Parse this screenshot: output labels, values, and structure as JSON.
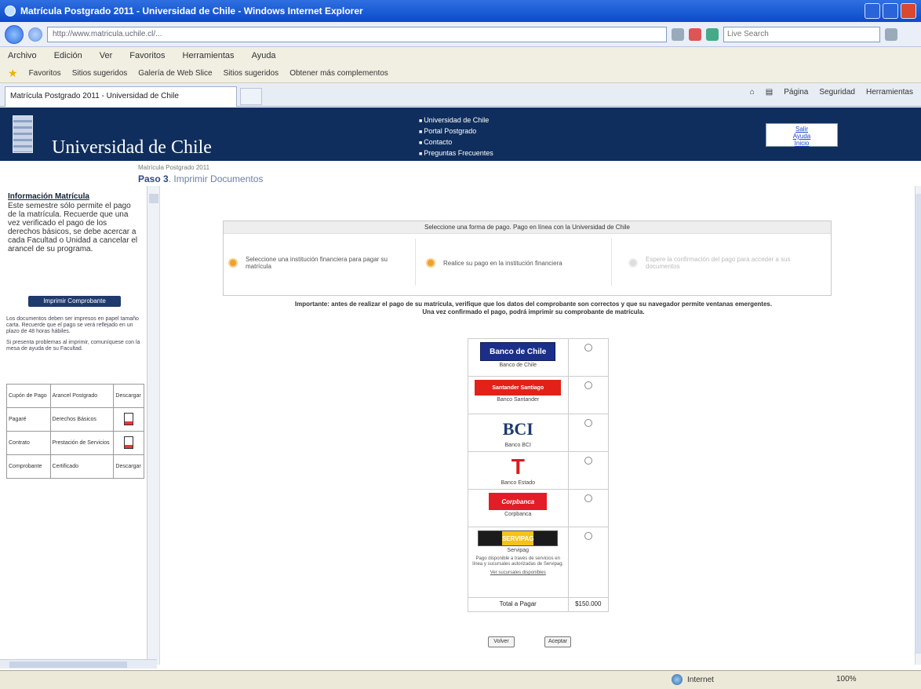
{
  "window": {
    "title": "Matrícula Postgrado 2011 - Universidad de Chile - Windows Internet Explorer"
  },
  "browser": {
    "url": "http://www.matricula.uchile.cl/...",
    "search_placeholder": "Live Search",
    "menu": [
      "Archivo",
      "Edición",
      "Ver",
      "Favoritos",
      "Herramientas",
      "Ayuda"
    ],
    "favorites_label": "Favoritos",
    "favorites": [
      "Sitios sugeridos",
      "Galería de Web Slice",
      "Sitios sugeridos",
      "Obtener más complementos"
    ],
    "tab_title": "Matrícula Postgrado 2011 - Universidad de Chile",
    "commands": [
      "Página",
      "Seguridad",
      "Herramientas"
    ]
  },
  "banner": {
    "university": "Universidad de Chile",
    "links": [
      "Universidad de Chile",
      "Portal Postgrado",
      "Contacto",
      "Preguntas Frecuentes"
    ],
    "login": [
      "Salir",
      "Ayuda",
      "Inicio"
    ]
  },
  "page": {
    "under_banner": "Matrícula Postgrado 2011",
    "heading_bold": "Paso 3",
    "heading_rest": ". Imprimir Documentos"
  },
  "sidebar": {
    "title": "Información Matrícula",
    "text": "Este semestre sólo permite el pago de la matrícula. Recuerde que una vez verificado el pago de los derechos básicos, se debe acercar a cada Facultad o Unidad a cancelar el arancel de su programa.",
    "button": "Imprimir Comprobante",
    "small1": "Los documentos deben ser impresos en papel tamaño carta. Recuerde que el pago se verá reflejado en un plazo de 48 horas hábiles.",
    "small2": "Si presenta problemas al imprimir, comuníquese con la mesa de ayuda de su Facultad.",
    "table": [
      [
        "Cupón de Pago",
        "Arancel Postgrado",
        "Descargar"
      ],
      [
        "Pagaré",
        "Derechos Básicos",
        ""
      ],
      [
        "Contrato",
        "Prestación de Servicios",
        ""
      ],
      [
        "Comprobante",
        "Certificado",
        "Descargar"
      ]
    ]
  },
  "steps": {
    "header": "Seleccione una forma de pago. Pago en línea con la Universidad de Chile",
    "items": [
      "Seleccione una institución financiera para pagar su matrícula",
      "Realice su pago en la institución financiera",
      "Espere la confirmación del pago para acceder a sus documentos"
    ]
  },
  "instructions": {
    "line1": "Importante: antes de realizar el pago de su matrícula, verifique que los datos del comprobante son correctos y que su navegador permite ventanas emergentes.",
    "line2": "Una vez confirmado el pago, podrá imprimir su comprobante de matrícula."
  },
  "banks": [
    {
      "logo": "Banco de Chile",
      "name": "Banco de Chile",
      "bg": "#1b2f8a",
      "fg": "#ffffff"
    },
    {
      "logo": "Santander Santiago",
      "name": "Banco Santander",
      "bg": "#e32119",
      "fg": "#ffffff"
    },
    {
      "logo": "BCI",
      "name": "Banco BCI",
      "bg": "#ffffff",
      "fg": "#1e3a70"
    },
    {
      "logo": "T",
      "name": "Banco Estado",
      "bg": "#ffffff",
      "fg": "#d61e1e"
    },
    {
      "logo": "Corpbanca",
      "name": "Corpbanca",
      "bg": "#e21d26",
      "fg": "#ffffff"
    },
    {
      "logo": "SERVIPAG",
      "name": "Servipag",
      "bg": "#f5c21a",
      "fg": "#1b1b1b",
      "note": "Pago disponible a través de servicios en línea y sucursales autorizadas de Servipag.",
      "note2": "Ver sucursales disponibles"
    }
  ],
  "total": {
    "label": "Total a Pagar",
    "value": "$150.000"
  },
  "buttons": {
    "back": "Volver",
    "continue": "Aceptar"
  },
  "status": {
    "zone": "Internet",
    "zoom": "100%"
  }
}
